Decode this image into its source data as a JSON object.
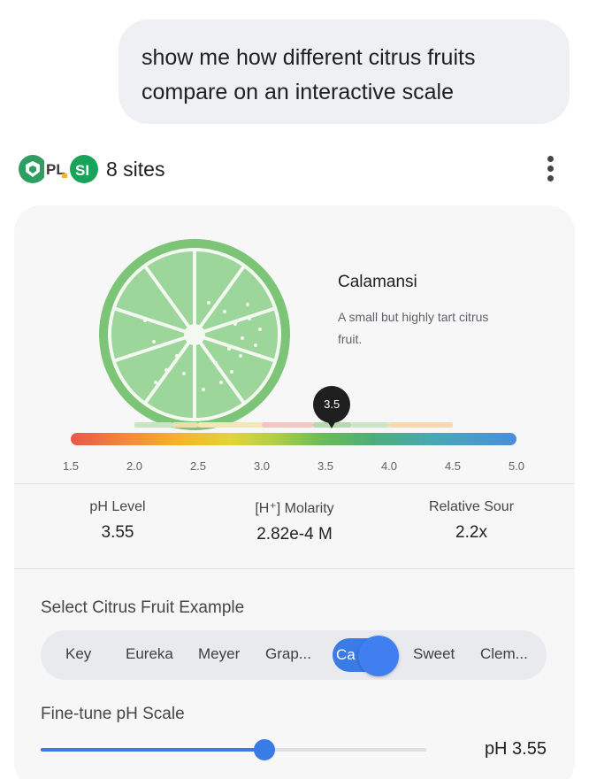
{
  "prompt": {
    "line1": "show me how different citrus fruits",
    "line2": "compare on an interactive scale"
  },
  "sources": {
    "count_label": "8 sites",
    "logos": [
      {
        "icon": "green-shield-logo",
        "color": "#2e9e62"
      },
      {
        "icon": "pl-logo",
        "color": "#4a4a4a"
      },
      {
        "icon": "si-logo",
        "color": "#19a35a"
      }
    ],
    "menu_icon": "more-vert-icon"
  },
  "fruit": {
    "name": "Calamansi",
    "description": "A small but highly tart citrus fruit.",
    "illustration": "lime-slice-illustration"
  },
  "scale": {
    "min": 1.5,
    "max": 5.0,
    "ticks": [
      "1.5",
      "2.0",
      "2.5",
      "3.0",
      "3.5",
      "4.0",
      "4.5",
      "5.0"
    ],
    "marker_label": "3.5",
    "marker_value": 3.55,
    "fruit_ranges": [
      {
        "from": 2.0,
        "to": 2.3,
        "color": "#c9e4c3"
      },
      {
        "from": 2.3,
        "to": 2.5,
        "color": "#eadfb1"
      },
      {
        "from": 2.5,
        "to": 3.0,
        "color": "#f3e7b8"
      },
      {
        "from": 3.0,
        "to": 3.4,
        "color": "#f4c6c0"
      },
      {
        "from": 3.4,
        "to": 3.7,
        "color": "#b8d8b0"
      },
      {
        "from": 3.7,
        "to": 4.0,
        "color": "#cfe5c8"
      },
      {
        "from": 4.0,
        "to": 4.5,
        "color": "#f6d9b0"
      }
    ]
  },
  "stats": [
    {
      "label": "pH Level",
      "value": "3.55"
    },
    {
      "label": "[H⁺] Molarity",
      "value": "2.82e-4 M"
    },
    {
      "label": "Relative Sour",
      "value": "2.2x"
    }
  ],
  "selector": {
    "label": "Select Citrus Fruit Example",
    "options": [
      "Key",
      "Eureka",
      "Meyer",
      "Grap...",
      "Ca",
      "Sweet",
      "Clem..."
    ],
    "selected_index": 4
  },
  "fine_tune": {
    "label": "Fine-tune pH Scale",
    "value": 3.55,
    "fraction": 0.58,
    "readout": "pH 3.55"
  },
  "colors": {
    "accent": "#3a7be6",
    "fruit_green": "#8fd08a",
    "fruit_rind": "#7cc476",
    "card_bg": "#f7f7f8"
  }
}
